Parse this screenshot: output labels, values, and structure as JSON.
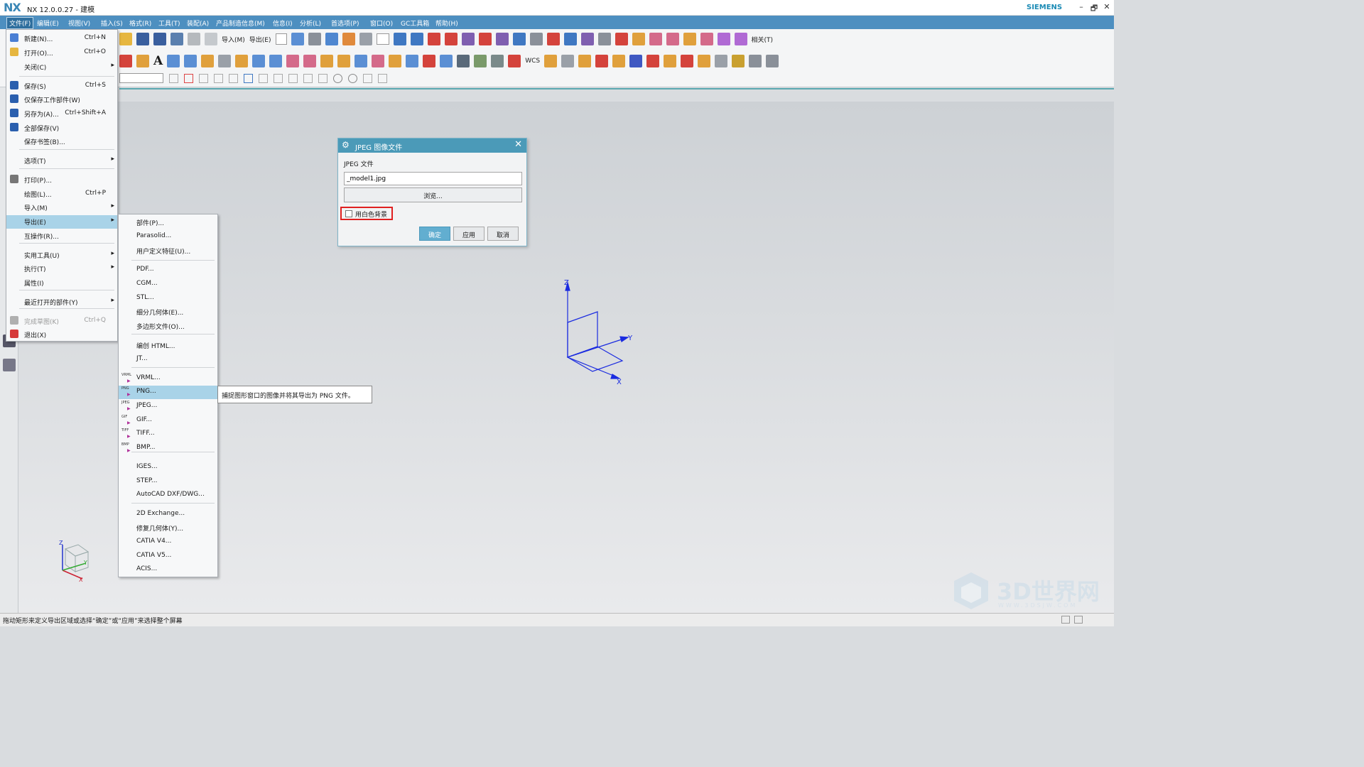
{
  "app": {
    "logo": "NX",
    "title": "NX 12.0.0.27 - 建模",
    "brand": "SIEMENS"
  },
  "window_controls": [
    "–",
    "🗗",
    "✕"
  ],
  "menubar": [
    "文件(F)",
    "编辑(E)",
    "视图(V)",
    "插入(S)",
    "格式(R)",
    "工具(T)",
    "装配(A)",
    "产品制造信息(M)",
    "信息(I)",
    "分析(L)",
    "首选项(P)",
    "窗口(O)",
    "GC工具箱",
    "帮助(H)"
  ],
  "toolbar": {
    "import_label": "导入(M)",
    "export_label": "导出(E)",
    "related_label": "相关(T)",
    "wcs_label": "WCS"
  },
  "file_menu": {
    "items": [
      {
        "label": "新建(N)...",
        "shortcut": "Ctrl+N",
        "icon": "new-file-icon",
        "color": "#4a7fd4"
      },
      {
        "label": "打开(O)...",
        "shortcut": "Ctrl+O",
        "icon": "open-folder-icon",
        "color": "#e6b640"
      },
      {
        "label": "关闭(C)",
        "submenu": true
      },
      {
        "label": "保存(S)",
        "shortcut": "Ctrl+S",
        "icon": "save-icon",
        "color": "#2a5fae"
      },
      {
        "label": "仅保存工作部件(W)",
        "icon": "save-work-part-icon",
        "color": "#2a5fae"
      },
      {
        "label": "另存为(A)...",
        "shortcut": "Ctrl+Shift+A",
        "icon": "save-as-icon",
        "color": "#2a5fae"
      },
      {
        "label": "全部保存(V)",
        "icon": "save-all-icon",
        "color": "#2a5fae"
      },
      {
        "label": "保存书签(B)..."
      },
      {
        "label": "选项(T)",
        "submenu": true
      },
      {
        "label": "打印(P)...",
        "icon": "print-icon",
        "color": "#777777"
      },
      {
        "label": "绘图(L)...",
        "shortcut": "Ctrl+P"
      },
      {
        "label": "导入(M)",
        "submenu": true
      },
      {
        "label": "导出(E)",
        "submenu": true,
        "highlighted": true
      },
      {
        "label": "互操作(R)..."
      },
      {
        "label": "实用工具(U)",
        "submenu": true
      },
      {
        "label": "执行(T)",
        "submenu": true
      },
      {
        "label": "属性(I)"
      },
      {
        "label": "最近打开的部件(Y)",
        "submenu": true
      },
      {
        "label": "完成草图(K)",
        "shortcut": "Ctrl+Q",
        "disabled": true,
        "icon": "finish-sketch-icon",
        "color": "#b0b0b0"
      },
      {
        "label": "退出(X)",
        "icon": "exit-icon",
        "color": "#d63a3a"
      }
    ]
  },
  "export_menu": {
    "items": [
      {
        "label": "部件(P)..."
      },
      {
        "label": "Parasolid..."
      },
      {
        "label": "用户定义特征(U)..."
      },
      {
        "label": "PDF..."
      },
      {
        "label": "CGM..."
      },
      {
        "label": "STL..."
      },
      {
        "label": "细分几何体(E)..."
      },
      {
        "label": "多边形文件(O)..."
      },
      {
        "label": "编创 HTML..."
      },
      {
        "label": "JT..."
      },
      {
        "label": "VRML...",
        "icon_text": "VRML"
      },
      {
        "label": "PNG...",
        "icon_text": "PNG",
        "highlighted": true
      },
      {
        "label": "JPEG...",
        "icon_text": "JPEG"
      },
      {
        "label": "GIF...",
        "icon_text": "GIF"
      },
      {
        "label": "TIFF...",
        "icon_text": "TIFF"
      },
      {
        "label": "BMP...",
        "icon_text": "BMP"
      },
      {
        "label": "IGES..."
      },
      {
        "label": "STEP..."
      },
      {
        "label": "AutoCAD DXF/DWG..."
      },
      {
        "label": "2D Exchange..."
      },
      {
        "label": "修复几何体(Y)..."
      },
      {
        "label": "CATIA V4..."
      },
      {
        "label": "CATIA V5..."
      },
      {
        "label": "ACIS..."
      }
    ]
  },
  "tooltip": "捕捉图形窗口的图像并将其导出为 PNG 文件。",
  "dialog": {
    "title": "JPEG 图像文件",
    "file_label": "JPEG 文件",
    "file_value": "_model1.jpg",
    "browse": "浏览...",
    "checkbox_label": "用白色背景",
    "checkbox_checked": false,
    "ok": "确定",
    "apply": "应用",
    "cancel": "取消"
  },
  "triad": {
    "x": "X",
    "y": "Y",
    "z": "Z"
  },
  "status_text": "拖动矩形来定义导出区域或选择“确定”或“应用”来选择整个屏幕",
  "watermark": {
    "text": "3D世界网",
    "sub": "WWW.3DSJW.COM"
  }
}
